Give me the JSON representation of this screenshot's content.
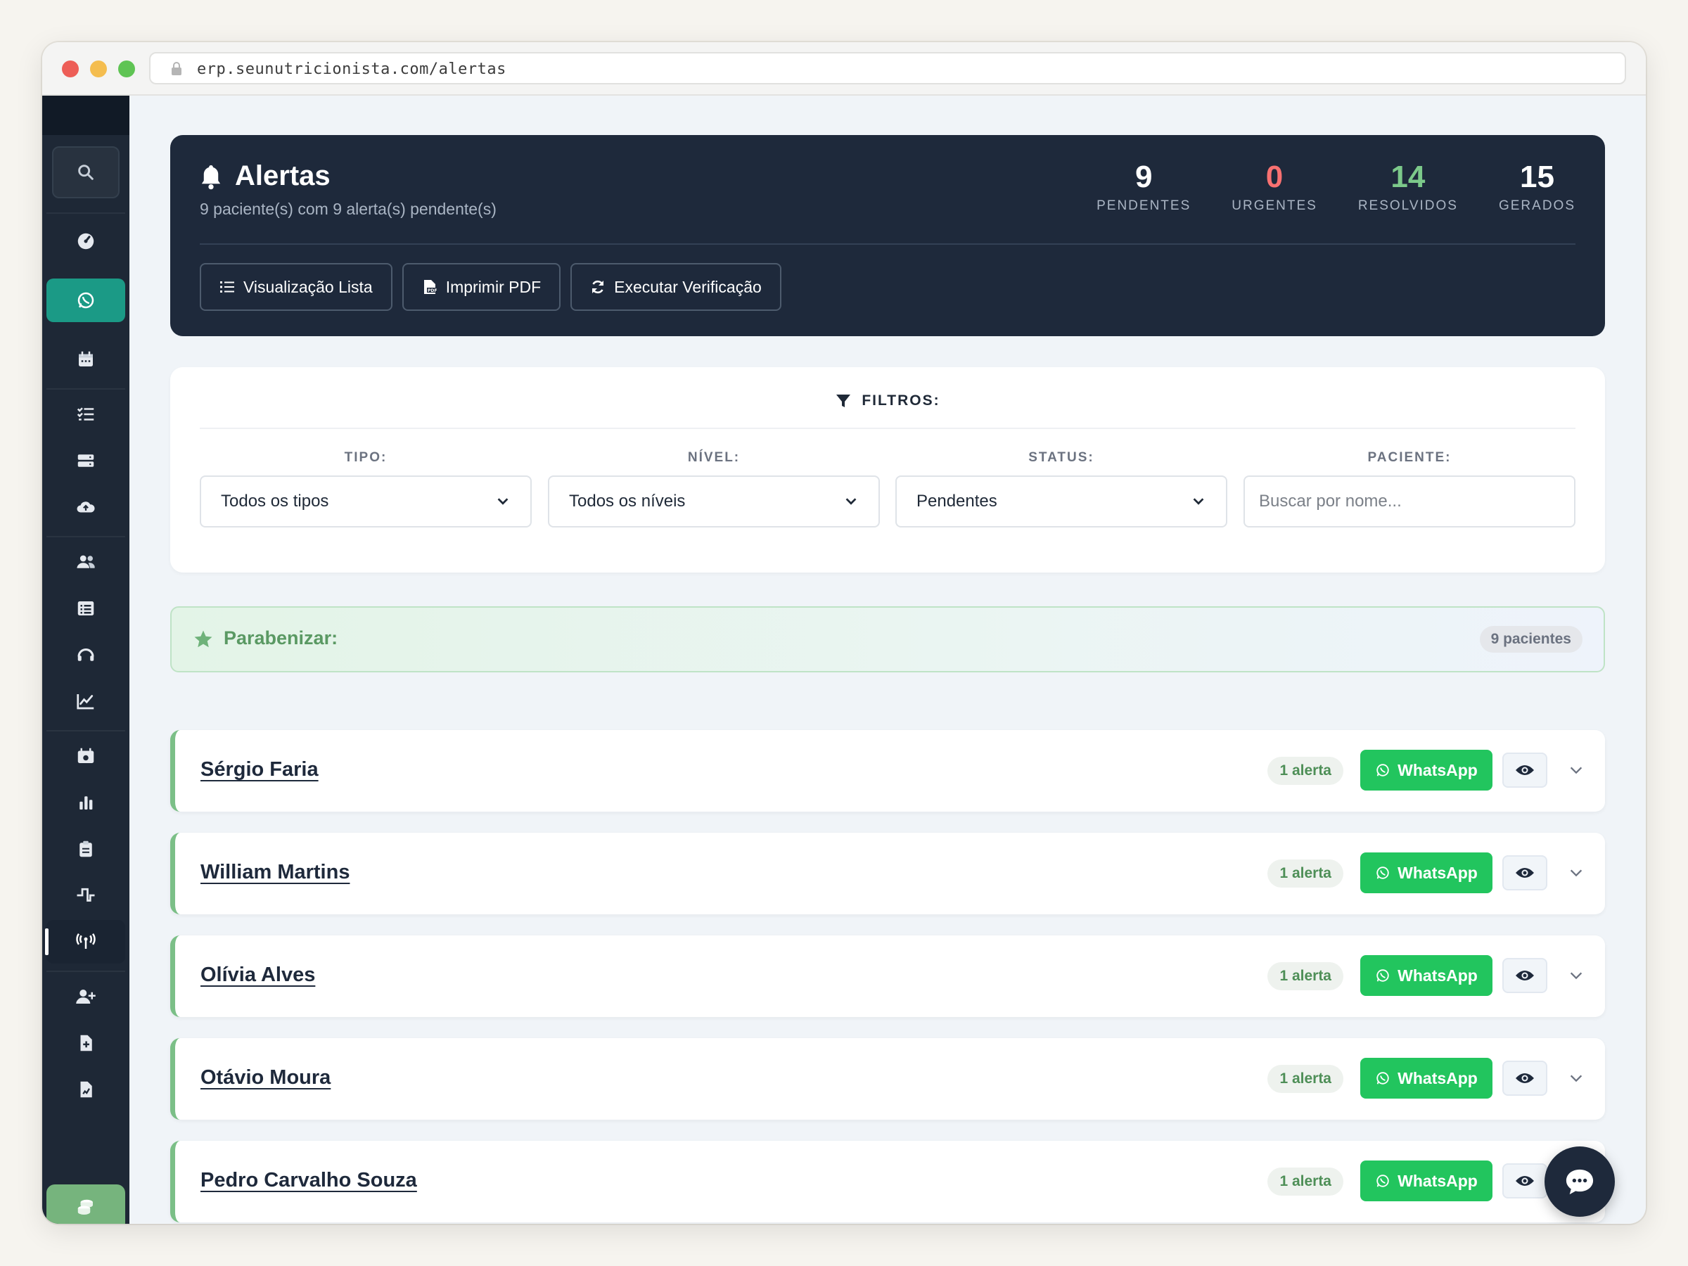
{
  "browser": {
    "url": "erp.seunutricionista.com/alertas"
  },
  "sidebar": {
    "items": [
      {
        "icon": "dashboard-icon"
      },
      {
        "icon": "whatsapp-icon",
        "active": true
      },
      {
        "icon": "calendar-icon"
      },
      {
        "icon": "checklist-icon"
      },
      {
        "icon": "server-icon"
      },
      {
        "icon": "cloud-upload-icon"
      },
      {
        "icon": "users-icon"
      },
      {
        "icon": "list-icon"
      },
      {
        "icon": "headset-icon"
      },
      {
        "icon": "line-chart-icon"
      },
      {
        "icon": "calendar-day-icon"
      },
      {
        "icon": "bar-chart-icon"
      },
      {
        "icon": "clipboard-icon"
      },
      {
        "icon": "signal-wave-icon"
      },
      {
        "icon": "broadcast-icon",
        "selected": true
      },
      {
        "icon": "user-plus-icon"
      },
      {
        "icon": "file-medical-icon"
      },
      {
        "icon": "file-chart-icon"
      },
      {
        "icon": "coins-icon"
      }
    ]
  },
  "header": {
    "title": "Alertas",
    "subtitle": "9 paciente(s) com 9 alerta(s) pendente(s)",
    "stats": [
      {
        "value": "9",
        "label": "PENDENTES",
        "color": "#ffffff"
      },
      {
        "value": "0",
        "label": "URGENTES",
        "color": "#f87171"
      },
      {
        "value": "14",
        "label": "RESOLVIDOS",
        "color": "#7cc98a"
      },
      {
        "value": "15",
        "label": "GERADOS",
        "color": "#ffffff"
      }
    ],
    "buttons": {
      "list_view": "Visualização Lista",
      "print_pdf": "Imprimir PDF",
      "run_check": "Executar Verificação"
    }
  },
  "filters": {
    "title": "FILTROS:",
    "tipo": {
      "label": "TIPO:",
      "value": "Todos os tipos"
    },
    "nivel": {
      "label": "NÍVEL:",
      "value": "Todos os níveis"
    },
    "status": {
      "label": "STATUS:",
      "value": "Pendentes"
    },
    "paciente": {
      "label": "PACIENTE:",
      "placeholder": "Buscar por nome..."
    }
  },
  "group": {
    "title": "Parabenizar:",
    "count": "9 pacientes"
  },
  "patients": [
    {
      "name": "Sérgio Faria",
      "badge": "1 alerta",
      "action": "WhatsApp"
    },
    {
      "name": "William Martins",
      "badge": "1 alerta",
      "action": "WhatsApp"
    },
    {
      "name": "Olívia Alves",
      "badge": "1 alerta",
      "action": "WhatsApp"
    },
    {
      "name": "Otávio Moura",
      "badge": "1 alerta",
      "action": "WhatsApp"
    },
    {
      "name": "Pedro Carvalho Souza",
      "badge": "1 alerta",
      "action": "WhatsApp"
    }
  ],
  "colors": {
    "accent_whatsapp": "#22c55e",
    "header_bg": "#1e293b",
    "sidebar_bg": "#1e2836",
    "success": "#7bbf87"
  }
}
